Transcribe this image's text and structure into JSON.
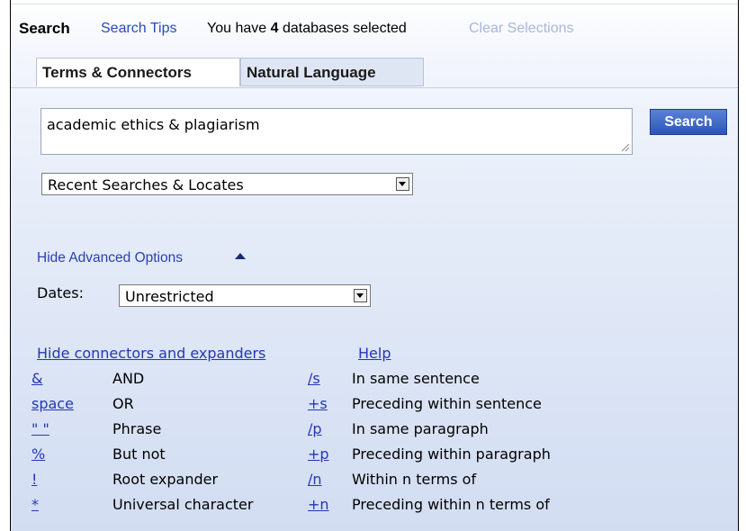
{
  "header": {
    "title": "Search",
    "search_tips": "Search Tips",
    "db_prefix": "You have ",
    "db_count": "4",
    "db_suffix": " databases selected",
    "clear_selections": "Clear Selections"
  },
  "tabs": [
    {
      "label": "Terms & Connectors",
      "active": true
    },
    {
      "label": "Natural Language",
      "active": false
    }
  ],
  "query": {
    "value": "academic ethics & plagiarism"
  },
  "search_button": "Search",
  "recent_select": {
    "value": "Recent Searches & Locates"
  },
  "advanced": {
    "toggle_label": "Hide Advanced Options"
  },
  "dates": {
    "label": "Dates:",
    "value": "Unrestricted"
  },
  "connectors": {
    "hide_label": "Hide connectors and expanders",
    "help_label": "Help",
    "rows": [
      {
        "sym": "&",
        "desc": "AND",
        "sym2": "/s",
        "desc2": "In same sentence"
      },
      {
        "sym": "space",
        "desc": "OR",
        "sym2": "+s",
        "desc2": "Preceding within sentence"
      },
      {
        "sym": "\" \"",
        "desc": "Phrase",
        "sym2": "/p",
        "desc2": "In same paragraph"
      },
      {
        "sym": "%",
        "desc": "But not",
        "sym2": "+p",
        "desc2": "Preceding within paragraph"
      },
      {
        "sym": "!",
        "desc": "Root expander",
        "sym2": "/n",
        "desc2": "Within n terms of"
      },
      {
        "sym": "*",
        "desc": "Universal character",
        "sym2": "+n",
        "desc2": "Preceding within n terms of"
      }
    ]
  },
  "colors": {
    "link": "#2436b8",
    "button": "#2c56b8",
    "muted_link": "#a9b7d8"
  },
  "icons": [
    "dropdown-arrow-icon",
    "collapse-arrow-icon",
    "resize-grip-icon"
  ]
}
